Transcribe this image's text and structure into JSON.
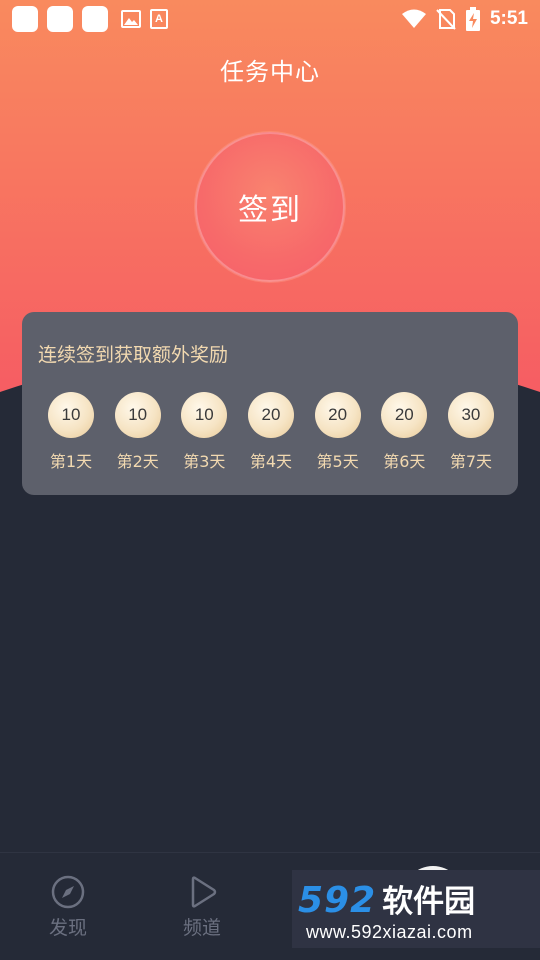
{
  "status_bar": {
    "time": "5:51",
    "icons": [
      "app-icon",
      "app-icon",
      "app-icon",
      "image-icon",
      "font-icon",
      "wifi-icon",
      "no-sim-icon",
      "battery-charging-icon"
    ]
  },
  "header": {
    "title": "任务中心"
  },
  "signin": {
    "label": "签到"
  },
  "reward_card": {
    "title": "连续签到获取额外奖励",
    "days": [
      {
        "coins": "10",
        "label": "第1天"
      },
      {
        "coins": "10",
        "label": "第2天"
      },
      {
        "coins": "10",
        "label": "第3天"
      },
      {
        "coins": "20",
        "label": "第4天"
      },
      {
        "coins": "20",
        "label": "第5天"
      },
      {
        "coins": "20",
        "label": "第6天"
      },
      {
        "coins": "30",
        "label": "第7天"
      }
    ]
  },
  "tabbar": {
    "tabs": [
      {
        "label": "发现",
        "icon": "compass-icon"
      },
      {
        "label": "频道",
        "icon": "play-icon"
      }
    ]
  },
  "watermark": {
    "brand_num": "592",
    "brand_cn": "软件园",
    "url": "www.592xiazai.com"
  },
  "colors": {
    "hero_top": "#f98a5e",
    "hero_bottom": "#f65d63",
    "background": "#252a37",
    "card": "#5d606b",
    "accent_text": "#f2d9b0"
  }
}
